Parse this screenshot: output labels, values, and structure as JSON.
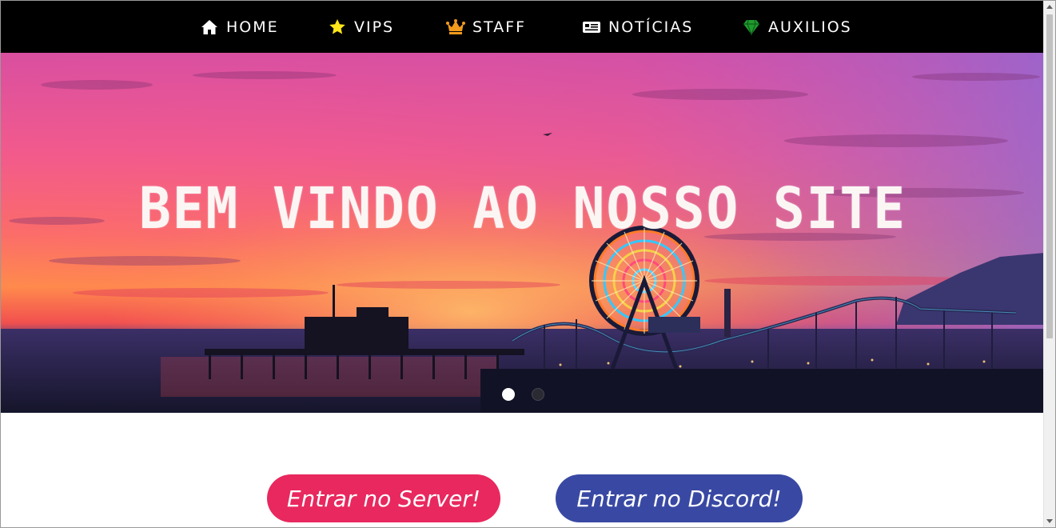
{
  "nav": {
    "items": [
      {
        "label": "HOME",
        "icon": "home-icon"
      },
      {
        "label": "VIPS",
        "icon": "star-icon"
      },
      {
        "label": "STAFF",
        "icon": "crown-icon"
      },
      {
        "label": "NOTÍCIAS",
        "icon": "newspaper-icon"
      },
      {
        "label": "AUXILIOS",
        "icon": "gem-icon"
      }
    ]
  },
  "hero": {
    "title": "BEM VINDO AO NOSSO SITE",
    "slide_count": 2,
    "active_slide": 1
  },
  "actions": {
    "server_label": "Entrar no Server!",
    "discord_label": "Entrar no Discord!"
  },
  "colors": {
    "navbar": "#000000",
    "server_button": "#e8285e",
    "discord_button": "#3949a3",
    "star_icon": "#ffe51a",
    "crown_icon": "#f29a1c",
    "gem_icon": "#1f9b2e"
  }
}
